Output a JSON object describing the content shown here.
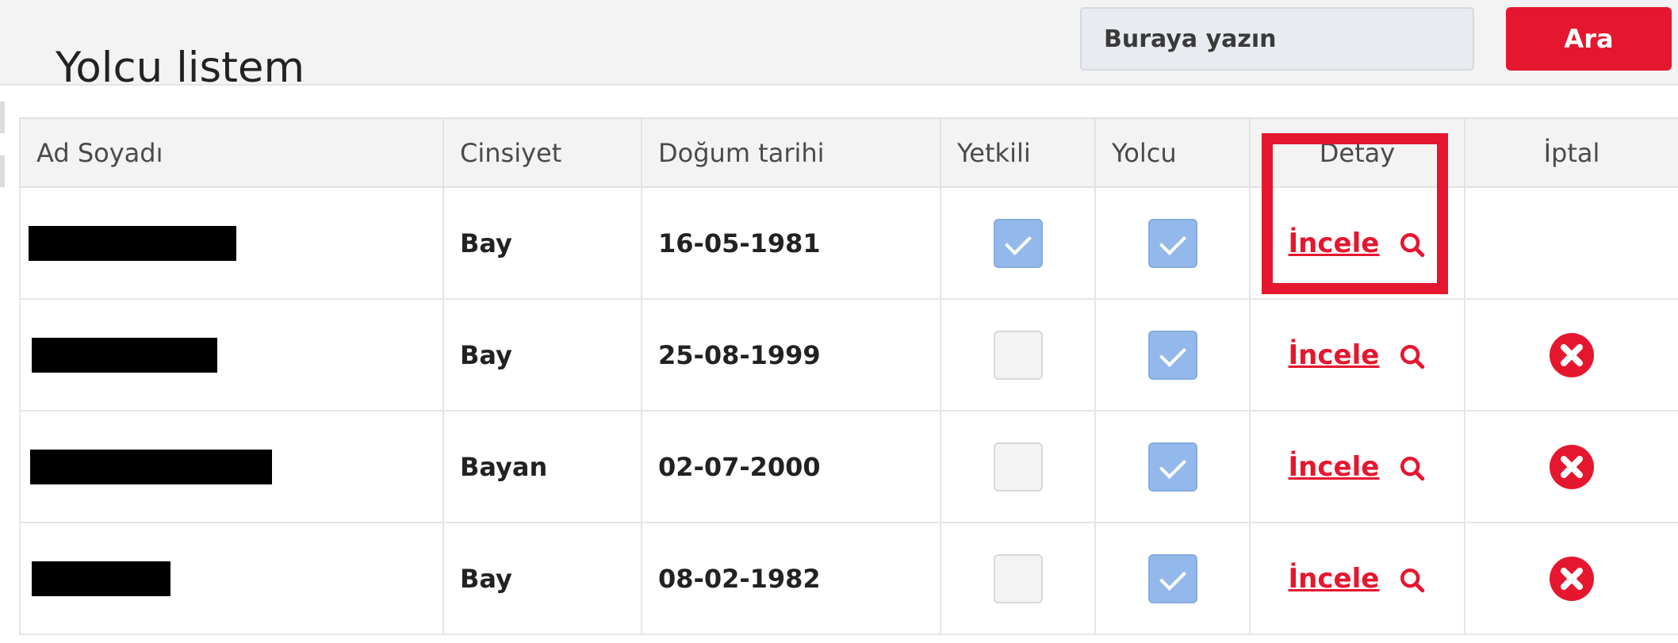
{
  "header": {
    "title": "Yolcu listem",
    "search_placeholder": "Buraya yazın",
    "search_value": "",
    "search_button_label": "Ara"
  },
  "table": {
    "columns": {
      "name": "Ad Soyadı",
      "gender": "Cinsiyet",
      "birthdate": "Doğum tarihi",
      "authorized": "Yetkili",
      "passenger": "Yolcu",
      "detail": "Detay",
      "cancel": "İptal"
    },
    "rows": [
      {
        "name": "[redacted]",
        "gender": "Bay",
        "birthdate": "16-05-1981",
        "authorized": true,
        "passenger": true,
        "detail_label": "İncele",
        "cancel_visible": false
      },
      {
        "name": "[redacted]",
        "gender": "Bay",
        "birthdate": "25-08-1999",
        "authorized": false,
        "passenger": true,
        "detail_label": "İncele",
        "cancel_visible": true
      },
      {
        "name": "[redacted]",
        "gender": "Bayan",
        "birthdate": "02-07-2000",
        "authorized": false,
        "passenger": true,
        "detail_label": "İncele",
        "cancel_visible": true
      },
      {
        "name": "[redacted]",
        "gender": "Bay",
        "birthdate": "08-02-1982",
        "authorized": false,
        "passenger": true,
        "detail_label": "İncele",
        "cancel_visible": true
      }
    ]
  },
  "icons": {
    "detail": "magnifier-icon",
    "cancel": "cancel-icon"
  },
  "colors": {
    "accent": "#e5172e",
    "checkbox_checked": "#93b9ea"
  }
}
